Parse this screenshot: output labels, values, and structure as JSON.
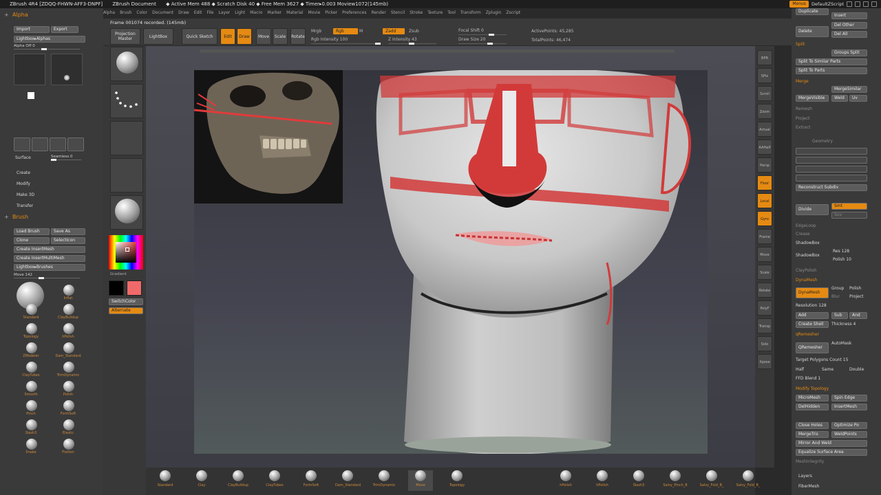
{
  "titlebar": {
    "app": "ZBrush 4R4 [ZDQQ-FHWN-AFF3-DNPF]",
    "doc": "ZBrush Document",
    "mem": "◆ Active Mem 488 ◆ Scratch Disk 40 ◆ Free Mem 3627 ◆ Timer▸0.003 Moview1072(145mb)",
    "menus_label": "Menus",
    "zscript": "DefaultZScript"
  },
  "menubar": [
    "Alpha",
    "Brush",
    "Color",
    "Document",
    "Draw",
    "Edit",
    "File",
    "Layer",
    "Light",
    "Macro",
    "Marker",
    "Material",
    "Movie",
    "Picker",
    "Preferences",
    "Render",
    "Stencil",
    "Stroke",
    "Texture",
    "Tool",
    "Transform",
    "Zplugin",
    "Zscript"
  ],
  "top_shelf": {
    "frame": "Frame 001074 recorded. (145mb)",
    "projection_master": "Projection Master",
    "lightbox": "LightBox",
    "quick_sketch": "Quick Sketch",
    "edit": "Edit",
    "draw": "Draw",
    "move": "Move",
    "scale": "Scale",
    "rotate": "Rotate",
    "mrgb": "Mrgb",
    "rgb": "Rgb",
    "m": "M",
    "zadd": "Zadd",
    "zsub": "Zsub",
    "rgb_intensity": "Rgb Intensity 100",
    "z_intensity": "Z Intensity 43",
    "focal_shift": "Focal Shift 0",
    "draw_size": "Draw Size 20",
    "active_points": "ActivePoints: 45,285",
    "total_points": "TotalPoints: 46,474"
  },
  "left": {
    "alpha_head": "Alpha",
    "import": "Import",
    "export": "Export",
    "lightbox_alphas": "Lightbox▸Alphas",
    "alpha_off": "Alpha Off 0",
    "surface": "Surface",
    "seamless": "Seamless 0",
    "create": "Create",
    "modify": "Modify",
    "make3d": "Make 3D",
    "transfer": "Transfer",
    "brush_head": "Brush",
    "load_brush": "Load Brush",
    "save_as": "Save As",
    "clone": "Clone",
    "select_icon": "SelectIcon",
    "create_insertmesh": "Create InsertMesh",
    "create_insertmultimesh": "Create InsertMultiMesh",
    "lightbox_brushes": "Lightbox▸Brushes",
    "move_slider": "Move 142",
    "brush_names": [
      "Move",
      "Inflat",
      "Standard",
      "ClayBuildup",
      "Topology",
      "hPolish",
      "ZModeler",
      "Dam_Standard",
      "ClayTubes",
      "TrimDynamic",
      "Smooth",
      "Polish",
      "Pinch",
      "FormSoft",
      "Slash3",
      "Elastic",
      "Snake",
      "Flatten"
    ],
    "gradient": "Gradient",
    "switch_color": "SwitchColor",
    "alternate": "Alternate"
  },
  "right": {
    "duplicate": "Duplicate",
    "insert": "Insert",
    "delete": "Delete",
    "del_other": "Del Other",
    "del_all": "Del All",
    "split": "Split",
    "groups_split": "Groups Split",
    "split_similar": "Split To Similar Parts",
    "split_parts": "Split To Parts",
    "merge": "Merge",
    "merge_visible": "MergeVisible",
    "merge_similar": "MergeSimilar",
    "weld": "Weld",
    "uv": "Uv",
    "remesh": "Remesh",
    "project": "Project",
    "extract": "Extract",
    "geometry": "Geometry",
    "reconstruct": "Reconstruct Subdiv",
    "divide": "Divide",
    "smt": "Smt",
    "suv": "Suv",
    "edgeloop": "EdgeLoop",
    "crease": "Crease",
    "shadowbox": "ShadowBox",
    "res128": "Res 128",
    "polish_10": "Polish 10",
    "claypolish": "ClayPolish",
    "dynamesh_head": "DynaMesh",
    "dynamesh": "DynaMesh",
    "group": "Group",
    "polish": "Polish",
    "blur": "Blur",
    "project_btn": "Project",
    "resolution": "Resolution 128",
    "add": "Add",
    "sub": "Sub",
    "and": "And",
    "create_shell": "Create Shell",
    "thickness": "Thickness 4",
    "qremesher_head": "qRemesher",
    "qremesher": "QRemesher",
    "automask": "AutoMask",
    "target_poly": "Target Polygons Count 15",
    "half": "Half",
    "same": "Same",
    "double": "Double",
    "adapt": "FFD Blend 1",
    "modify_topology": "Modify Topology",
    "micromesh": "MicroMesh",
    "spin_edge": "Spin Edge",
    "delhidden": "DelHidden",
    "insertmesh": "InsertMesh",
    "close_holes": "Close Holes",
    "optimize": "Optimize Po",
    "mergetris": "MergeTris",
    "weldpoints": "WeldPoints",
    "mirror_weld": "Mirror And Weld",
    "equalize": "Equalize Surface Area",
    "meshintegrity": "MeshIntegrity",
    "layers": "Layers",
    "fibermesh": "FiberMesh"
  },
  "right_shelf": [
    "BPR",
    "SPix",
    "Scroll",
    "Zoom",
    "Actual",
    "AAHalf",
    "Persp",
    "Floor",
    "Local",
    "Gyro",
    "Frame",
    "Move",
    "Scale",
    "Rotate",
    "PolyF",
    "Transp",
    "Solo",
    "Xpose"
  ],
  "bottom_shelf": [
    "Standard",
    "Clay",
    "ClayBuildup",
    "ClayTubes",
    "FormSoft",
    "Dam_Standard",
    "TrimDynamic",
    "Move",
    "Topology",
    "hPolish",
    "hPolish",
    "Slash3",
    "Salvy_Pinch_B",
    "Salvy_Fold_B_",
    "Salvy_Fold_B_"
  ],
  "colors": {
    "accent": "#e58a12",
    "paint": "#d23a3a",
    "main_color": "#000000",
    "secondary_color": "#f06a6a"
  }
}
